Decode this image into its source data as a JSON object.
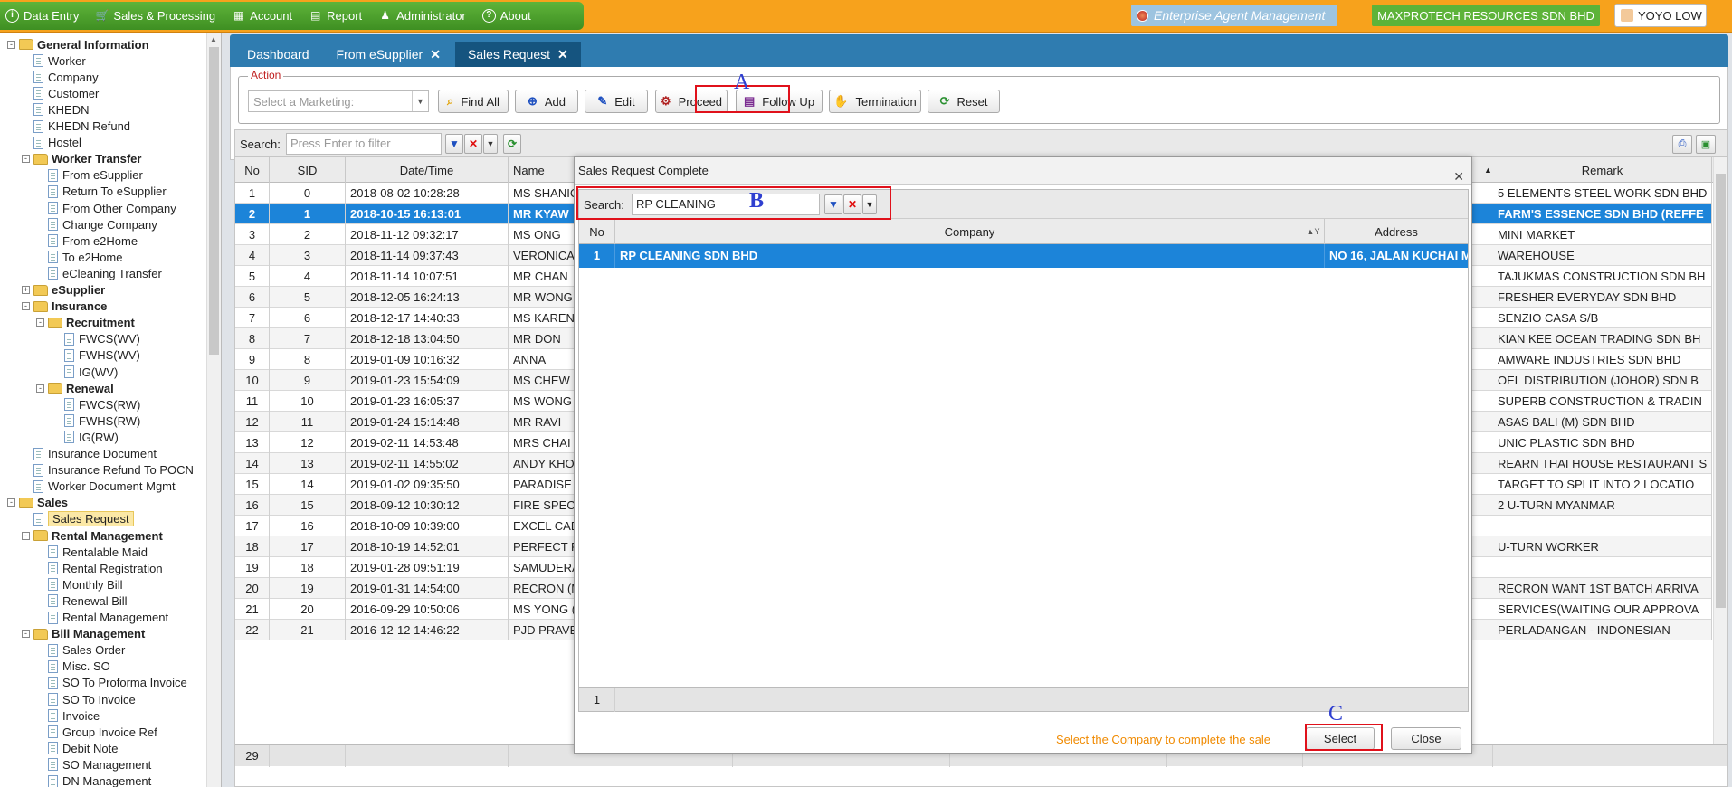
{
  "menu": {
    "items": [
      {
        "label": "Data Entry",
        "icon": "info-circle-icon"
      },
      {
        "label": "Sales & Processing",
        "icon": "cart-icon"
      },
      {
        "label": "Account",
        "icon": "calculator-icon"
      },
      {
        "label": "Report",
        "icon": "table-icon"
      },
      {
        "label": "Administrator",
        "icon": "users-icon"
      },
      {
        "label": "About",
        "icon": "question-circle-icon"
      }
    ]
  },
  "header": {
    "system_name": "Enterprise Agent Management",
    "company": "MAXPROTECH RESOURCES SDN BHD",
    "user": "YOYO LOW"
  },
  "sidebar": {
    "nodes": [
      {
        "label": "General Information",
        "type": "folder",
        "level": 0,
        "bold": true,
        "toggle": "-"
      },
      {
        "label": "Worker",
        "type": "doc",
        "level": 1
      },
      {
        "label": "Company",
        "type": "doc",
        "level": 1
      },
      {
        "label": "Customer",
        "type": "doc",
        "level": 1
      },
      {
        "label": "KHEDN",
        "type": "doc",
        "level": 1
      },
      {
        "label": "KHEDN Refund",
        "type": "doc",
        "level": 1
      },
      {
        "label": "Hostel",
        "type": "doc",
        "level": 1
      },
      {
        "label": "Worker Transfer",
        "type": "folder",
        "level": 1,
        "bold": true,
        "toggle": "-"
      },
      {
        "label": "From eSupplier",
        "type": "doc",
        "level": 2
      },
      {
        "label": "Return To eSupplier",
        "type": "doc",
        "level": 2
      },
      {
        "label": "From Other Company",
        "type": "doc",
        "level": 2
      },
      {
        "label": "Change Company",
        "type": "doc",
        "level": 2
      },
      {
        "label": "From e2Home",
        "type": "doc",
        "level": 2
      },
      {
        "label": "To e2Home",
        "type": "doc",
        "level": 2
      },
      {
        "label": "eCleaning Transfer",
        "type": "doc",
        "level": 2
      },
      {
        "label": "eSupplier",
        "type": "folder",
        "level": 1,
        "bold": true,
        "toggle": "+"
      },
      {
        "label": "Insurance",
        "type": "folder",
        "level": 1,
        "bold": true,
        "toggle": "-"
      },
      {
        "label": "Recruitment",
        "type": "folder",
        "level": 2,
        "bold": true,
        "toggle": "-"
      },
      {
        "label": "FWCS(WV)",
        "type": "doc",
        "level": 3
      },
      {
        "label": "FWHS(WV)",
        "type": "doc",
        "level": 3
      },
      {
        "label": "IG(WV)",
        "type": "doc",
        "level": 3
      },
      {
        "label": "Renewal",
        "type": "folder",
        "level": 2,
        "bold": true,
        "toggle": "-"
      },
      {
        "label": "FWCS(RW)",
        "type": "doc",
        "level": 3
      },
      {
        "label": "FWHS(RW)",
        "type": "doc",
        "level": 3
      },
      {
        "label": "IG(RW)",
        "type": "doc",
        "level": 3
      },
      {
        "label": "Insurance Document",
        "type": "doc",
        "level": 1
      },
      {
        "label": "Insurance Refund To POCN",
        "type": "doc",
        "level": 1
      },
      {
        "label": "Worker Document Mgmt",
        "type": "doc",
        "level": 1
      },
      {
        "label": "Sales",
        "type": "folder",
        "level": 0,
        "bold": true,
        "toggle": "-"
      },
      {
        "label": "Sales Request",
        "type": "doc",
        "level": 1,
        "selected": true
      },
      {
        "label": "Rental Management",
        "type": "folder",
        "level": 1,
        "bold": true,
        "toggle": "-"
      },
      {
        "label": "Rentalable Maid",
        "type": "doc",
        "level": 2
      },
      {
        "label": "Rental Registration",
        "type": "doc",
        "level": 2
      },
      {
        "label": "Monthly Bill",
        "type": "doc",
        "level": 2
      },
      {
        "label": "Renewal Bill",
        "type": "doc",
        "level": 2
      },
      {
        "label": "Rental Management",
        "type": "doc",
        "level": 2
      },
      {
        "label": "Bill Management",
        "type": "folder",
        "level": 1,
        "bold": true,
        "toggle": "-"
      },
      {
        "label": "Sales Order",
        "type": "doc",
        "level": 2
      },
      {
        "label": "Misc. SO",
        "type": "doc",
        "level": 2
      },
      {
        "label": "SO To Proforma Invoice",
        "type": "doc",
        "level": 2
      },
      {
        "label": "SO To Invoice",
        "type": "doc",
        "level": 2
      },
      {
        "label": "Invoice",
        "type": "doc",
        "level": 2
      },
      {
        "label": "Group Invoice Ref",
        "type": "doc",
        "level": 2
      },
      {
        "label": "Debit Note",
        "type": "doc",
        "level": 2
      },
      {
        "label": "SO Management",
        "type": "doc",
        "level": 2
      },
      {
        "label": "DN Management",
        "type": "doc",
        "level": 2
      }
    ]
  },
  "tabs": [
    {
      "label": "Dashboard",
      "closable": false,
      "active": false
    },
    {
      "label": "From eSupplier",
      "closable": true,
      "active": false
    },
    {
      "label": "Sales Request",
      "closable": true,
      "active": true
    }
  ],
  "action": {
    "legend": "Action",
    "marketing_placeholder": "Select a Marketing:",
    "find_all": "Find All",
    "add": "Add",
    "edit": "Edit",
    "proceed": "Proceed",
    "follow_up": "Follow Up",
    "termination": "Termination",
    "reset": "Reset"
  },
  "grid": {
    "search_label": "Search:",
    "search_placeholder": "Press Enter to filter",
    "columns": {
      "no": "No",
      "sid": "SID",
      "datetime": "Date/Time",
      "name": "Name",
      "remark": "Remark"
    },
    "rows": [
      {
        "no": "1",
        "sid": "0",
        "datetime": "2018-08-02 10:28:28",
        "name": "MS SHANICE",
        "remark": "5 ELEMENTS STEEL WORK SDN BHD"
      },
      {
        "no": "2",
        "sid": "1",
        "datetime": "2018-10-15 16:13:01",
        "name": "MR KYAW",
        "remark": "FARM'S ESSENCE SDN BHD (REFFE"
      },
      {
        "no": "3",
        "sid": "2",
        "datetime": "2018-11-12 09:32:17",
        "name": "MS ONG",
        "remark": "MINI MARKET"
      },
      {
        "no": "4",
        "sid": "3",
        "datetime": "2018-11-14 09:37:43",
        "name": "VERONICA",
        "remark": "WAREHOUSE"
      },
      {
        "no": "5",
        "sid": "4",
        "datetime": "2018-11-14 10:07:51",
        "name": "MR CHAN",
        "remark": "TAJUKMAS CONSTRUCTION SDN BH"
      },
      {
        "no": "6",
        "sid": "5",
        "datetime": "2018-12-05 16:24:13",
        "name": "MR WONG",
        "remark": "FRESHER EVERYDAY SDN BHD"
      },
      {
        "no": "7",
        "sid": "6",
        "datetime": "2018-12-17 14:40:33",
        "name": "MS KAREN",
        "remark": "SENZIO CASA S/B"
      },
      {
        "no": "8",
        "sid": "7",
        "datetime": "2018-12-18 13:04:50",
        "name": "MR DON",
        "remark": "KIAN KEE OCEAN TRADING SDN BH"
      },
      {
        "no": "9",
        "sid": "8",
        "datetime": "2019-01-09 10:16:32",
        "name": "ANNA",
        "remark": "AMWARE INDUSTRIES SDN BHD"
      },
      {
        "no": "10",
        "sid": "9",
        "datetime": "2019-01-23 15:54:09",
        "name": "MS CHEW",
        "remark": "OEL DISTRIBUTION (JOHOR) SDN B"
      },
      {
        "no": "11",
        "sid": "10",
        "datetime": "2019-01-23 16:05:37",
        "name": "MS WONG",
        "remark": "SUPERB CONSTRUCTION & TRADIN"
      },
      {
        "no": "12",
        "sid": "11",
        "datetime": "2019-01-24 15:14:48",
        "name": "MR RAVI",
        "remark": "ASAS BALI (M) SDN BHD"
      },
      {
        "no": "13",
        "sid": "12",
        "datetime": "2019-02-11 14:53:48",
        "name": "MRS CHAI BU",
        "remark": "UNIC PLASTIC SDN BHD"
      },
      {
        "no": "14",
        "sid": "13",
        "datetime": "2019-02-11 14:55:02",
        "name": "ANDY KHOO",
        "remark": "REARN THAI HOUSE RESTAURANT S"
      },
      {
        "no": "15",
        "sid": "14",
        "datetime": "2019-01-02 09:35:50",
        "name": "PARADISE IN",
        "remark": "TARGET TO SPLIT INTO 2 LOCATIO"
      },
      {
        "no": "16",
        "sid": "15",
        "datetime": "2018-09-12 10:30:12",
        "name": "FIRE SPECIAL",
        "remark": "2 U-TURN MYANMAR"
      },
      {
        "no": "17",
        "sid": "16",
        "datetime": "2018-10-09 10:39:00",
        "name": "EXCEL CABIN",
        "remark": ""
      },
      {
        "no": "18",
        "sid": "17",
        "datetime": "2018-10-19 14:52:01",
        "name": "PERFECT FIN",
        "remark": "U-TURN WORKER"
      },
      {
        "no": "19",
        "sid": "18",
        "datetime": "2019-01-28 09:51:19",
        "name": "SAMUDERA B",
        "remark": ""
      },
      {
        "no": "20",
        "sid": "19",
        "datetime": "2019-01-31 14:54:00",
        "name": "RECRON (MA",
        "remark": "RECRON WANT 1ST BATCH ARRIVA"
      },
      {
        "no": "21",
        "sid": "20",
        "datetime": "2016-09-29 10:50:06",
        "name": "MS YONG (KE",
        "remark": "SERVICES(WAITING OUR APPROVA"
      },
      {
        "no": "22",
        "sid": "21",
        "datetime": "2016-12-12 14:46:22",
        "name": "PJD PRAVEST",
        "remark": "PERLADANGAN - INDONESIAN"
      }
    ],
    "selected_row": 1,
    "footer_count": "29"
  },
  "dialog": {
    "title": "Sales Request Complete",
    "search_label": "Search:",
    "search_value": "RP CLEANING",
    "columns": {
      "no": "No",
      "company": "Company",
      "address": "Address"
    },
    "row": {
      "no": "1",
      "company": "RP CLEANING SDN BHD",
      "address": "NO 16, JALAN KUCHAI M..."
    },
    "footer_count": "1",
    "hint": "Select the Company to complete the sale",
    "select_label": "Select",
    "close_label": "Close"
  },
  "annotations": [
    "A",
    "B",
    "C"
  ],
  "colors": {
    "topbar": "#f7a21c",
    "menubar": "#4aa02c",
    "tabbar": "#2f7cb0",
    "selection": "#1c84d9",
    "annotation_box": "#e0111b",
    "annotation_letter": "#2f3fd0",
    "hint": "#f08a00"
  }
}
